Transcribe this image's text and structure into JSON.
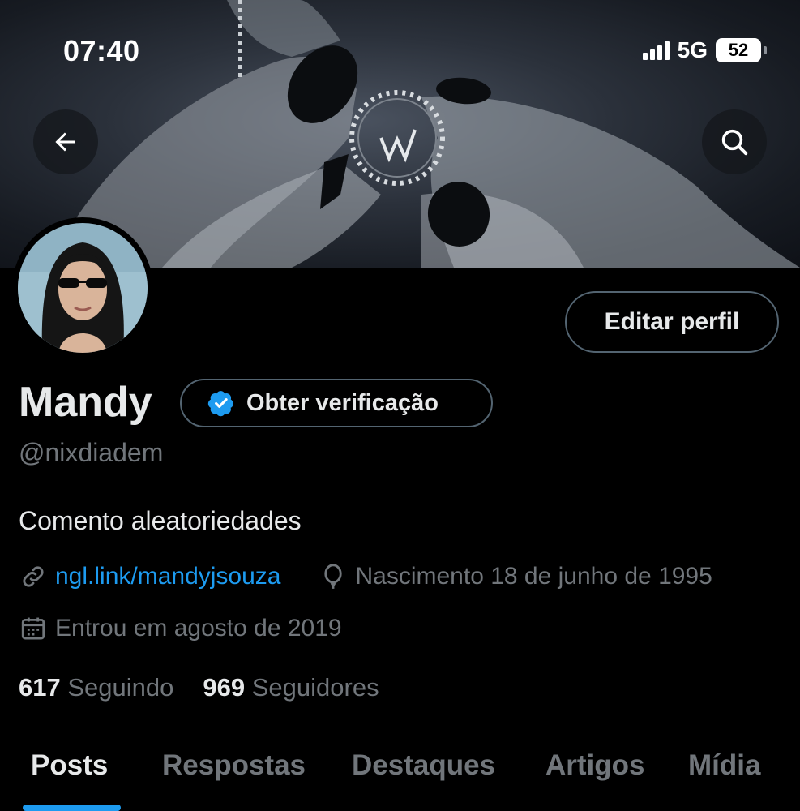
{
  "status_bar": {
    "time": "07:40",
    "network": "5G",
    "battery": "52"
  },
  "header": {
    "back_icon": "arrow-left-icon",
    "search_icon": "search-icon"
  },
  "profile": {
    "edit_label": "Editar perfil",
    "name": "Mandy",
    "verify_label": "Obter verificação",
    "handle": "@nixdiadem",
    "bio": "Comento aleatoriedades",
    "link": "ngl.link/mandyjsouza",
    "birth": "Nascimento 18 de junho de 1995",
    "joined": "Entrou em agosto de 2019",
    "following_count": "617",
    "following_label": "Seguindo",
    "followers_count": "969",
    "followers_label": "Seguidores"
  },
  "tabs": [
    {
      "label": "Posts",
      "active": true
    },
    {
      "label": "Respostas",
      "active": false
    },
    {
      "label": "Destaques",
      "active": false
    },
    {
      "label": "Artigos",
      "active": false
    },
    {
      "label": "Mídia",
      "active": false
    }
  ],
  "colors": {
    "accent": "#1d9bf0",
    "muted": "#71767b",
    "border": "#536471"
  }
}
